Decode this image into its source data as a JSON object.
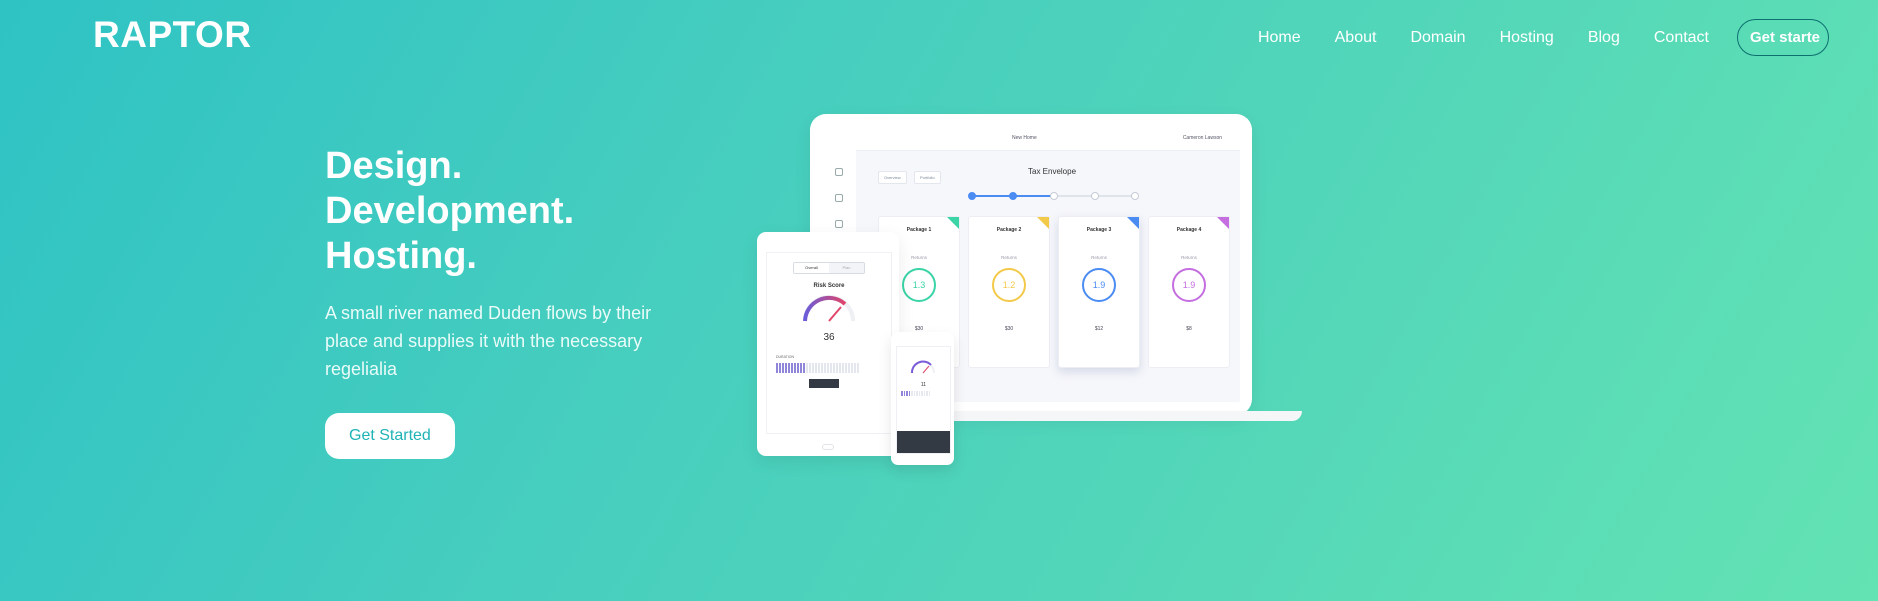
{
  "brand": "RAPTOR",
  "nav": {
    "items": [
      "Home",
      "About",
      "Domain",
      "Hosting",
      "Blog",
      "Contact"
    ],
    "cta": "Get starte"
  },
  "hero": {
    "line1": "Design.",
    "line2": "Development.",
    "line3": "Hosting.",
    "description": "A small river named Duden flows by their place and supplies it with the necessary regelialia",
    "cta": "Get Started"
  },
  "mockup": {
    "laptop": {
      "tab_label": "New Home",
      "user_label": "Cameron Lawson",
      "title": "Tax Envelope",
      "filters": [
        "Overview",
        "Portfolio"
      ],
      "packages": [
        {
          "name": "Package 1",
          "value": "1.3",
          "color": "#3ad4a6"
        },
        {
          "name": "Package 2",
          "value": "1.2",
          "color": "#f3c94a"
        },
        {
          "name": "Package 3",
          "value": "1.9",
          "color": "#4a8cf2"
        },
        {
          "name": "Package 4",
          "value": "1.9",
          "color": "#c46ee0"
        }
      ],
      "returns_label": "Returns",
      "footer_values": [
        "$30",
        "$30",
        "$12",
        "$8"
      ]
    },
    "tablet": {
      "tabs": [
        "Overall",
        "Plan"
      ],
      "title": "Risk Score",
      "score": "36",
      "duration_label": "DURATION"
    },
    "phone": {
      "score": "11"
    },
    "colors": {
      "accent": "#4a8cf2",
      "gauge_start": "#6a5cd9",
      "gauge_end": "#e0456a"
    }
  }
}
